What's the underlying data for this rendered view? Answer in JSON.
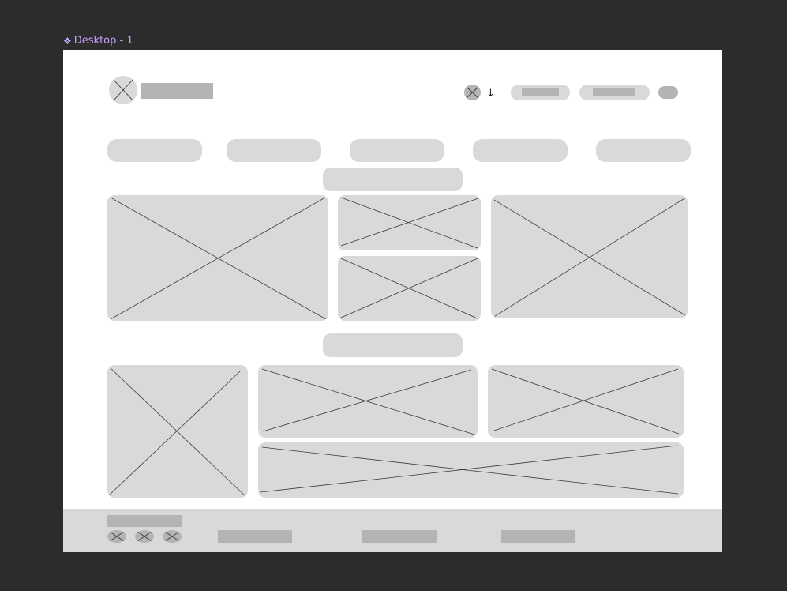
{
  "frame": {
    "label": "Desktop - 1",
    "label_icon": "component-diamond-icon",
    "label_color": "#c5a6ff",
    "canvas_bg": "#2c2c2c",
    "frame_bg": "#ffffff",
    "placeholder_color": "#d9d9d9",
    "bar_color": "#b4b4b4"
  },
  "header": {
    "logo_icon": "image-placeholder-icon",
    "language_icon": "image-placeholder-icon",
    "dropdown_arrow": "↓"
  }
}
